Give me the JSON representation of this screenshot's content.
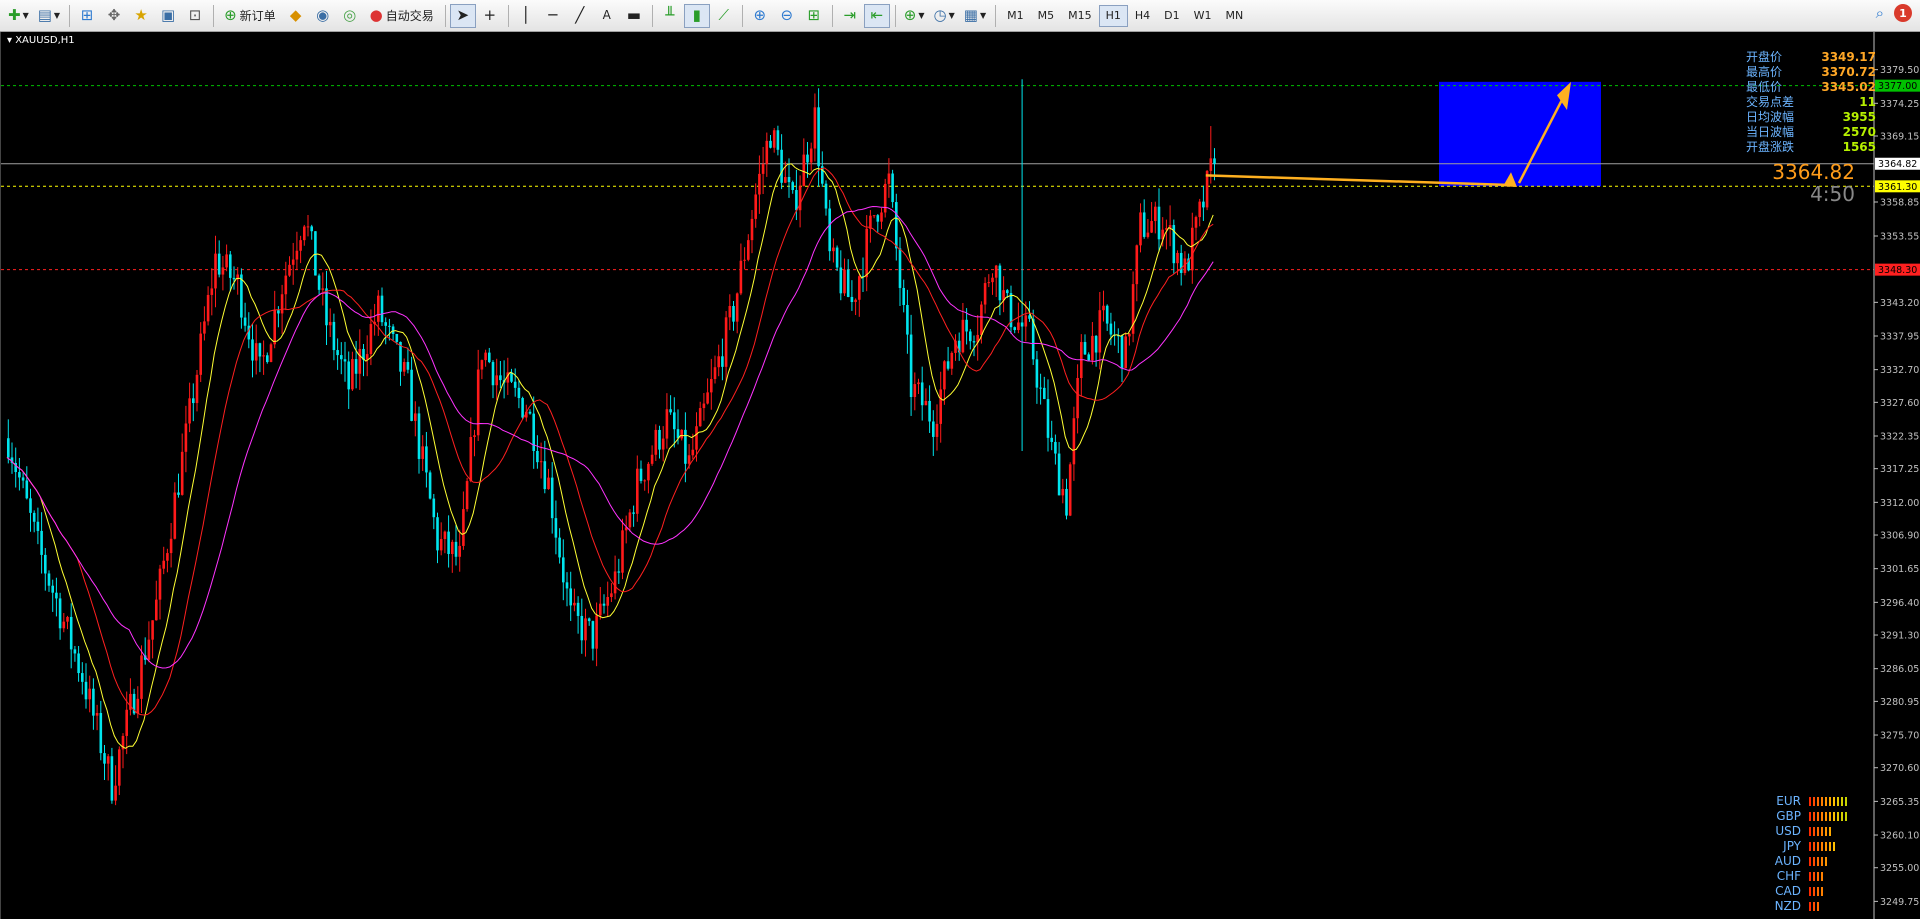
{
  "toolbar": {
    "new_order_label": "新订单",
    "auto_trade_label": "自动交易",
    "timeframes": [
      "M1",
      "M5",
      "M15",
      "H1",
      "H4",
      "D1",
      "W1",
      "MN"
    ],
    "active_timeframe": "H1",
    "notification_count": "1"
  },
  "chart": {
    "symbol_label": "XAUUSD,H1",
    "big_price": "3364.82",
    "timer": "4:50",
    "info": [
      {
        "label": "开盘价",
        "value": "3349.17"
      },
      {
        "label": "最高价",
        "value": "3370.72"
      },
      {
        "label": "最低价",
        "value": "3345.02"
      },
      {
        "label": "交易点差",
        "value": "11"
      },
      {
        "label": "日均波幅",
        "value": "3955"
      },
      {
        "label": "当日波幅",
        "value": "2570"
      },
      {
        "label": "开盘涨跌",
        "value": "1565"
      }
    ],
    "price_axis": [
      "3379.50",
      "3374.25",
      "3369.15",
      "3358.85",
      "3353.55",
      "3343.20",
      "3337.95",
      "3332.70",
      "3327.60",
      "3322.35",
      "3317.25",
      "3312.00",
      "3306.90",
      "3301.65",
      "3296.40",
      "3291.30",
      "3286.05",
      "3280.95",
      "3275.70",
      "3270.60",
      "3265.35",
      "3260.10",
      "3255.00",
      "3249.75"
    ],
    "price_tags": [
      {
        "value": "3377.00",
        "color": "#00c000",
        "text_color": "#000000"
      },
      {
        "value": "3364.82",
        "color": "#ffffff",
        "text_color": "#000000"
      },
      {
        "value": "3361.30",
        "color": "#ffff00",
        "text_color": "#000000"
      },
      {
        "value": "3348.30",
        "color": "#ff2020",
        "text_color": "#000000"
      }
    ],
    "colors": {
      "bull": "#ff1a1a",
      "bear": "#00e5ee",
      "ma_fast": "#ffff33",
      "ma_mid": "#ff2020",
      "ma_slow": "#ff33ff",
      "zone": "#0000ff",
      "arrow": "#ffb020"
    }
  },
  "currency_strength": [
    {
      "name": "EUR",
      "level": 10
    },
    {
      "name": "GBP",
      "level": 10
    },
    {
      "name": "USD",
      "level": 6
    },
    {
      "name": "JPY",
      "level": 7
    },
    {
      "name": "AUD",
      "level": 5
    },
    {
      "name": "CHF",
      "level": 4
    },
    {
      "name": "CAD",
      "level": 4
    },
    {
      "name": "NZD",
      "level": 3
    }
  ]
}
